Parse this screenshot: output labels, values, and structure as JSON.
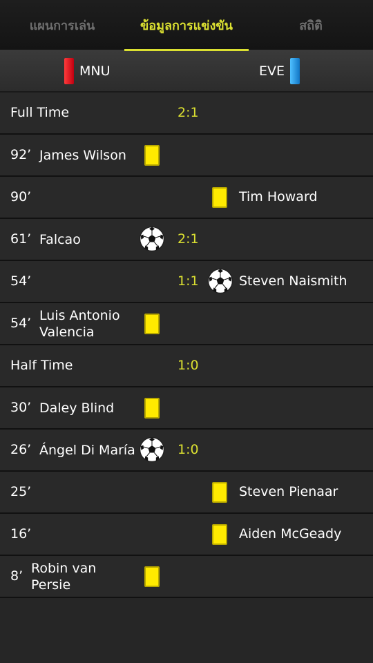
{
  "tabs": [
    "แผนการเล่น",
    "ข้อมูลการแข่งขัน",
    "สถิติ"
  ],
  "teams": {
    "home": "MNU",
    "away": "EVE"
  },
  "events": [
    {
      "type": "period",
      "label": "Full Time",
      "score": "2:1"
    },
    {
      "type": "yellow",
      "side": "home",
      "minute": "92’",
      "player": "James Wilson"
    },
    {
      "type": "yellow",
      "side": "away",
      "minute": "90’",
      "player": "Tim Howard"
    },
    {
      "type": "goal",
      "side": "home",
      "minute": "61’",
      "player": "Falcao",
      "score": "2:1"
    },
    {
      "type": "goal",
      "side": "away",
      "minute": "54’",
      "player": "Steven Naismith",
      "score": "1:1"
    },
    {
      "type": "yellow",
      "side": "home",
      "minute": "54’",
      "player": "Luis Antonio Valencia"
    },
    {
      "type": "period",
      "label": "Half Time",
      "score": "1:0"
    },
    {
      "type": "yellow",
      "side": "home",
      "minute": "30’",
      "player": "Daley Blind"
    },
    {
      "type": "goal",
      "side": "home",
      "minute": "26’",
      "player": "Ángel Di María",
      "score": "1:0"
    },
    {
      "type": "yellow",
      "side": "away",
      "minute": "25’",
      "player": "Steven Pienaar"
    },
    {
      "type": "yellow",
      "side": "away",
      "minute": "16’",
      "player": "Aiden McGeady"
    },
    {
      "type": "yellow",
      "side": "home",
      "minute": "8’",
      "player": "Robin van Persie"
    }
  ],
  "colors": {
    "accent": "#dbe031",
    "home_team": "#e0102a",
    "away_team": "#2a9ee8",
    "yellow_card": "#ffea00"
  }
}
